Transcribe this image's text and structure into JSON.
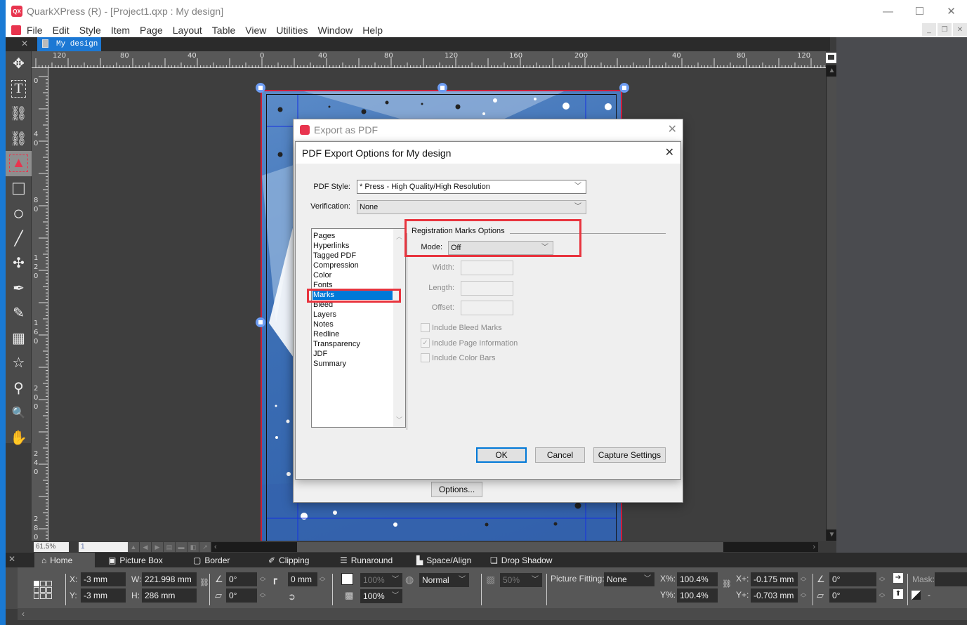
{
  "window": {
    "title": "QuarkXPress (R) - [Project1.qxp : My design]",
    "minimize": "—",
    "maximize": "☐",
    "close": "✕"
  },
  "menubar": {
    "items": [
      "File",
      "Edit",
      "Style",
      "Item",
      "Page",
      "Layout",
      "Table",
      "View",
      "Utilities",
      "Window",
      "Help"
    ]
  },
  "doc_tab": {
    "label": "My design"
  },
  "toolbox": {
    "tools": [
      {
        "name": "item-tool",
        "glyph": "✥"
      },
      {
        "name": "text-content-tool",
        "glyph": "T"
      },
      {
        "name": "linking-tool",
        "glyph": "⛓"
      },
      {
        "name": "unlinking-tool",
        "glyph": "⛓"
      },
      {
        "name": "picture-content-tool",
        "glyph": "▲",
        "active": true
      },
      {
        "name": "rectangle-box-tool",
        "glyph": "□"
      },
      {
        "name": "oval-box-tool",
        "glyph": "○"
      },
      {
        "name": "line-tool",
        "glyph": "╱"
      },
      {
        "name": "point-tool",
        "glyph": "✣"
      },
      {
        "name": "bezier-pen-tool",
        "glyph": "✒"
      },
      {
        "name": "freehand-tool",
        "glyph": "✎"
      },
      {
        "name": "table-tool",
        "glyph": "▦"
      },
      {
        "name": "starburst-tool",
        "glyph": "☆"
      },
      {
        "name": "eyedropper-tool",
        "glyph": "⚲"
      },
      {
        "name": "zoom-tool",
        "glyph": "🔍"
      },
      {
        "name": "pan-tool",
        "glyph": "✋"
      }
    ]
  },
  "rulers": {
    "top": [
      "120",
      "80",
      "40",
      "0",
      "40",
      "80",
      "120",
      "160",
      "200",
      "40",
      "80",
      "120"
    ],
    "left": [
      "0",
      "40",
      "80",
      "120",
      "160",
      "200",
      "240",
      "280"
    ]
  },
  "statusbar": {
    "zoom": "61.5%",
    "page": "1"
  },
  "export_dialog": {
    "title": "Export as PDF",
    "options_button": "Options..."
  },
  "pdf_options_dialog": {
    "title": "PDF Export Options for My design",
    "pdf_style_label": "PDF Style:",
    "pdf_style_value": "* Press - High Quality/High Resolution",
    "verification_label": "Verification:",
    "verification_value": "None",
    "categories": [
      "Pages",
      "Hyperlinks",
      "Tagged PDF",
      "Compression",
      "Color",
      "Fonts",
      "Marks",
      "Bleed",
      "Layers",
      "Notes",
      "Redline",
      "Transparency",
      "JDF",
      "Summary"
    ],
    "selected_category": "Marks",
    "group_title": "Registration Marks Options",
    "mode_label": "Mode:",
    "mode_value": "Off",
    "width_label": "Width:",
    "width_value": "",
    "length_label": "Length:",
    "length_value": "",
    "offset_label": "Offset:",
    "offset_value": "",
    "checkboxes": [
      {
        "label": "Include Bleed Marks",
        "checked": false
      },
      {
        "label": "Include Page Information",
        "checked": true
      },
      {
        "label": "Include Color Bars",
        "checked": false
      }
    ],
    "ok": "OK",
    "cancel": "Cancel",
    "capture": "Capture Settings"
  },
  "measurements": {
    "tabs": [
      "Home",
      "Picture Box",
      "Border",
      "Clipping",
      "Runaround",
      "Space/Align",
      "Drop Shadow"
    ],
    "x_label": "X:",
    "x": "-3 mm",
    "y_label": "Y:",
    "y": "-3 mm",
    "w_label": "W:",
    "w": "221.998 mm",
    "h_label": "H:",
    "h": "286 mm",
    "angle": "0°",
    "skew": "0°",
    "corner_radius": "0 mm",
    "opacity": "100%",
    "opacity2": "100%",
    "blend_mode": "Normal",
    "shadow_opacity": "50%",
    "picture_fitting_label": "Picture Fitting:",
    "picture_fitting": "None",
    "xpct_label": "X%:",
    "xpct": "100.4%",
    "ypct_label": "Y%:",
    "ypct": "100.4%",
    "xoff_label": "X+:",
    "xoff": "-0.175 mm",
    "yoff_label": "Y+:",
    "yoff": "-0.703 mm",
    "pic_angle": "0°",
    "pic_skew": "0°",
    "mask_label": "Mask:",
    "mask_value": "",
    "mask_dash": "-"
  }
}
